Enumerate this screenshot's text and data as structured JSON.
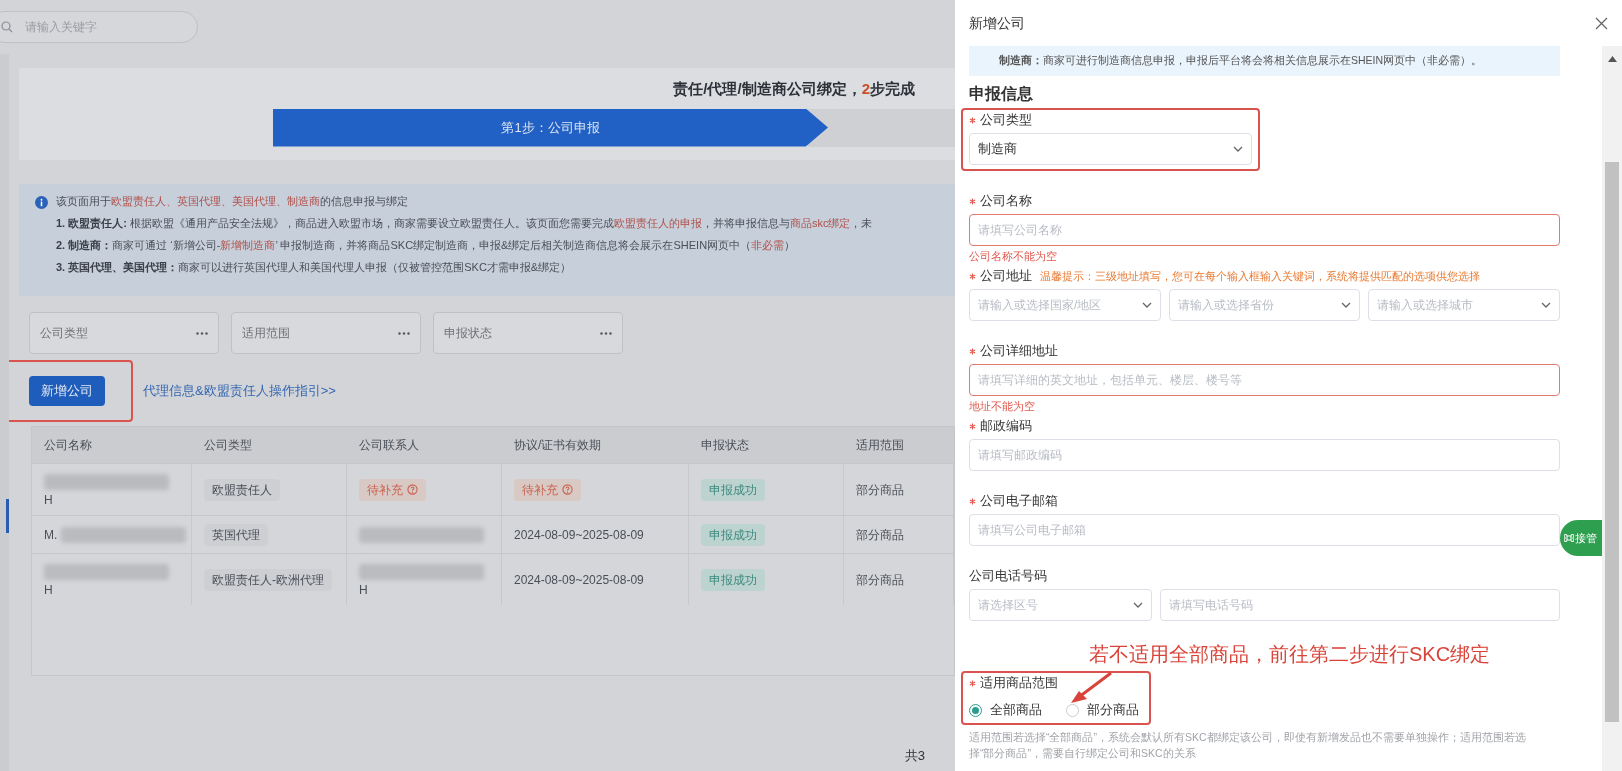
{
  "search": {
    "placeholder": "请输入关键字"
  },
  "page": {
    "title_parts": [
      {
        "kind": "plain",
        "text": "责任/代理/制造商公司绑定，"
      },
      {
        "kind": "accent",
        "text": "2"
      },
      {
        "kind": "plain",
        "text": "步完成"
      }
    ],
    "steps": [
      {
        "label": "第1步：公司申报",
        "selected": true
      }
    ],
    "info_lines": [
      [
        {
          "kind": "plain",
          "text": "该页面用于"
        },
        {
          "kind": "red",
          "text": "欧盟责任人、英国代理、美国代理、制造商"
        },
        {
          "kind": "plain",
          "text": "的信息申报与绑定"
        }
      ],
      [
        {
          "kind": "bold",
          "text": "1. 欧盟责任人: "
        },
        {
          "kind": "plain",
          "text": "根据欧盟《通用产品安全法规》，商品进入欧盟市场，商家需要设立欧盟责任人。该页面您需要完成"
        },
        {
          "kind": "red",
          "text": "欧盟责任人的申报"
        },
        {
          "kind": "plain",
          "text": "，并将申报信息与"
        },
        {
          "kind": "red",
          "text": "商品skc绑定"
        },
        {
          "kind": "plain",
          "text": "，未"
        }
      ],
      [
        {
          "kind": "bold",
          "text": "2. 制造商："
        },
        {
          "kind": "plain",
          "text": "商家可通过 ‘新增公司-"
        },
        {
          "kind": "red",
          "text": "新增制造商"
        },
        {
          "kind": "plain",
          "text": "’ 申报制造商，并将商品SKC绑定制造商，申报&绑定后相关制造商信息将会展示在SHEIN网页中（"
        },
        {
          "kind": "red",
          "text": "非必需"
        },
        {
          "kind": "plain",
          "text": "）"
        }
      ],
      [
        {
          "kind": "bold",
          "text": "3. 英国代理、美国代理："
        },
        {
          "kind": "plain",
          "text": "商家可以进行英国代理人和美国代理人申报（仅被管控范围SKC才需申报&绑定）"
        }
      ]
    ],
    "filters": [
      "公司类型",
      "适用范围",
      "申报状态"
    ],
    "add_button": {
      "label": "新增公司",
      "annotated": true
    },
    "guide_link": "代理信息&欧盟责任人操作指引>>",
    "table": {
      "columns": [
        "公司名称",
        "公司类型",
        "公司联系人",
        "协议/证书有效期",
        "申报状态",
        "适用范围"
      ],
      "rows": [
        {
          "cells": [
            {
              "kind": "redacted",
              "lines": [
                [
                  {
                    "kind": "blur"
                  }
                ],
                [
                  {
                    "kind": "text",
                    "text": "H"
                  }
                ]
              ]
            },
            {
              "kind": "tag",
              "text": "欧盟责任人"
            },
            {
              "kind": "pending",
              "text": "待补充"
            },
            {
              "kind": "pending",
              "text": "待补充"
            },
            {
              "kind": "success",
              "text": "申报成功"
            },
            {
              "kind": "text",
              "text": "部分商品"
            }
          ]
        },
        {
          "cells": [
            {
              "kind": "redacted",
              "lines": [
                [
                  {
                    "kind": "text",
                    "text": "M."
                  },
                  {
                    "kind": "blur"
                  }
                ]
              ]
            },
            {
              "kind": "tag",
              "text": "英国代理"
            },
            {
              "kind": "redacted",
              "lines": [
                [
                  {
                    "kind": "blur"
                  }
                ]
              ]
            },
            {
              "kind": "text",
              "text": "2024-08-09~2025-08-09"
            },
            {
              "kind": "success",
              "text": "申报成功"
            },
            {
              "kind": "text",
              "text": "部分商品"
            }
          ]
        },
        {
          "cells": [
            {
              "kind": "redacted",
              "lines": [
                [
                  {
                    "kind": "blur"
                  }
                ],
                [
                  {
                    "kind": "text",
                    "text": "H"
                  }
                ]
              ]
            },
            {
              "kind": "tag",
              "text": "欧盟责任人-欧洲代理"
            },
            {
              "kind": "redacted",
              "lines": [
                [
                  {
                    "kind": "blur"
                  }
                ],
                [
                  {
                    "kind": "text",
                    "text": "H"
                  }
                ]
              ]
            },
            {
              "kind": "text",
              "text": "2024-08-09~2025-08-09"
            },
            {
              "kind": "success",
              "text": "申报成功"
            },
            {
              "kind": "text",
              "text": "部分商品"
            }
          ]
        }
      ]
    },
    "total": "共3"
  },
  "drawer": {
    "title": "新增公司",
    "notice": "**制造商：**商家可进行制造商信息申报，申报后平台将会将相关信息展示在SHEIN网页中（非必需）。",
    "section_title": "申报信息",
    "fields": [
      {
        "kind": "select",
        "label": "公司类型",
        "required": true,
        "annotated": true,
        "value": "制造商"
      },
      {
        "kind": "input",
        "label": "公司名称",
        "required": true,
        "placeholder": "请填写公司名称",
        "error": "公司名称不能为空"
      },
      {
        "kind": "address",
        "label": "公司地址",
        "required": true,
        "hint": "温馨提示：三级地址填写，您可在每个输入框输入关键词，系统将提供匹配的选项供您选择",
        "placeholders": [
          "请输入或选择国家/地区",
          "请输入或选择省份",
          "请输入或选择城市"
        ]
      },
      {
        "kind": "input",
        "label": "公司详细地址",
        "required": true,
        "placeholder": "请填写详细的英文地址，包括单元、楼层、楼号等",
        "error": "地址不能为空"
      },
      {
        "kind": "input",
        "label": "邮政编码",
        "required": true,
        "placeholder": "请填写邮政编码"
      },
      {
        "kind": "input",
        "label": "公司电子邮箱",
        "required": true,
        "placeholder": "请填写公司电子邮箱"
      },
      {
        "kind": "phone",
        "label": "公司电话号码",
        "placeholders": [
          "请选择区号",
          "请填写电话号码"
        ]
      },
      {
        "kind": "radio",
        "label": "适用商品范围",
        "required": true,
        "annotated": true,
        "callout": "若不适用全部商品，前往第二步进行SKC绑定",
        "options": [
          {
            "label": "全部商品",
            "selected": true
          },
          {
            "label": "部分商品",
            "selected": false
          }
        ],
        "help": "适用范围若选择“全部商品”，系统会默认所有SKC都绑定该公司，即使有新增发品也不需要单独操作；适用范围若选择“部分商品”，需要自行绑定公司和SKC的关系"
      }
    ]
  },
  "float_button": "接管"
}
